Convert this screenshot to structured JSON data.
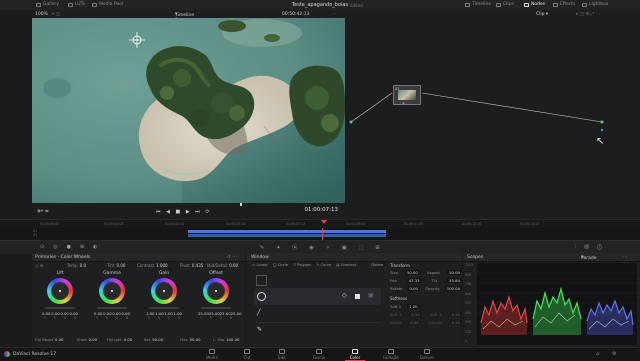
{
  "app_name": "DaVinci Resolve 17",
  "topbar": {
    "left_items": [
      {
        "label": "Gallery",
        "icon": "gallery-icon"
      },
      {
        "label": "LUTs",
        "icon": "luts-icon"
      },
      {
        "label": "Media Pool",
        "icon": "media-pool-icon"
      }
    ],
    "project_title": "Teste_apagando_boias",
    "project_status": "Edited",
    "right_items": [
      {
        "label": "Timeline",
        "icon": "timeline-icon"
      },
      {
        "label": "Clips",
        "icon": "clips-icon"
      },
      {
        "label": "Nodes",
        "icon": "nodes-icon",
        "active": true
      },
      {
        "label": "Effects",
        "icon": "effects-icon"
      },
      {
        "label": "Lightbox",
        "icon": "lightbox-icon"
      }
    ]
  },
  "viewer": {
    "zoom": "100%",
    "timeline_name": "Timeline 1",
    "source_timecode": "00:50:42:13",
    "current_timecode": "01:00:07:13"
  },
  "node_editor": {
    "mode": "Clip",
    "node_label": "01"
  },
  "timeline_ruler": {
    "ticks": [
      "01:00:00:00",
      "01:00:02:03",
      "01:00:04:01",
      "01:00:05:18",
      "01:00:07:13",
      "01:00:09:05",
      "01:00:11:00",
      "01:00:12:20",
      "01:00:14:23"
    ]
  },
  "color_wheels": {
    "title": "Primaries - Color Wheels",
    "params_top": [
      {
        "label": "Temp",
        "value": "0.0"
      },
      {
        "label": "Tint",
        "value": "0.00"
      },
      {
        "label": "Contrast",
        "value": "1.000"
      },
      {
        "label": "Pivot",
        "value": "0.435"
      },
      {
        "label": "Mid/Detail",
        "value": "0.00"
      }
    ],
    "wheels": [
      {
        "label": "Lift",
        "values": [
          "0.00",
          "0.00",
          "0.00",
          "0.00"
        ]
      },
      {
        "label": "Gamma",
        "values": [
          "0.00",
          "0.00",
          "0.00",
          "0.00"
        ]
      },
      {
        "label": "Gain",
        "values": [
          "1.00",
          "1.00",
          "1.00",
          "1.00"
        ]
      },
      {
        "label": "Offset",
        "values": [
          "25.00",
          "25.00",
          "25.00",
          "25.00"
        ]
      }
    ],
    "rgb_labels": [
      "Y",
      "R",
      "G",
      "B"
    ],
    "params_bottom": [
      {
        "label": "Col Boost",
        "value": "0.00"
      },
      {
        "label": "Shad",
        "value": "0.00"
      },
      {
        "label": "Hi/Light",
        "value": "0.00"
      },
      {
        "label": "Sat",
        "value": "50.00"
      },
      {
        "label": "Hue",
        "value": "50.00"
      },
      {
        "label": "L. Mix",
        "value": "100.00"
      }
    ]
  },
  "window_panel": {
    "title": "Window",
    "tools": [
      "Linear",
      "Circle",
      "Polygon",
      "Curve",
      "Gradient",
      "Delete"
    ],
    "transform": {
      "title": "Transform",
      "rows": [
        {
          "label": "Size",
          "value": "50.00",
          "label2": "Aspect",
          "value2": "50.00"
        },
        {
          "label": "Pan",
          "value": "47.33",
          "label2": "Tilt",
          "value2": "55.84"
        },
        {
          "label": "Rotate",
          "value": "0.00",
          "label2": "Opacity",
          "value2": "100.00"
        }
      ]
    },
    "softness": {
      "title": "Softness",
      "rows": [
        {
          "label": "Soft 1",
          "value": "1.20"
        },
        {
          "label": "Soft 3",
          "value": "0.50",
          "label2": "Soft 4",
          "value2": "0.50"
        },
        {
          "label": "Inside",
          "value": "0.50",
          "label2": "Outside",
          "value2": "0.50"
        }
      ]
    }
  },
  "scopes": {
    "title": "Scopes",
    "mode": "Parade",
    "scale": [
      "1023",
      "896",
      "768",
      "640",
      "512",
      "384",
      "256",
      "128",
      "0"
    ]
  },
  "pages": [
    {
      "label": "Media",
      "icon": "media-page-icon"
    },
    {
      "label": "Cut",
      "icon": "cut-page-icon"
    },
    {
      "label": "Edit",
      "icon": "edit-page-icon"
    },
    {
      "label": "Fusion",
      "icon": "fusion-page-icon"
    },
    {
      "label": "Color",
      "icon": "color-page-icon",
      "active": true
    },
    {
      "label": "Fairlight",
      "icon": "fairlight-page-icon"
    },
    {
      "label": "Deliver",
      "icon": "deliver-page-icon"
    }
  ],
  "colors": {
    "playhead": "#e23b3b",
    "active_page": "#e8e8ea",
    "parade_red": "#ff3b3b",
    "parade_green": "#3bff5a",
    "parade_blue": "#5a6bff"
  }
}
